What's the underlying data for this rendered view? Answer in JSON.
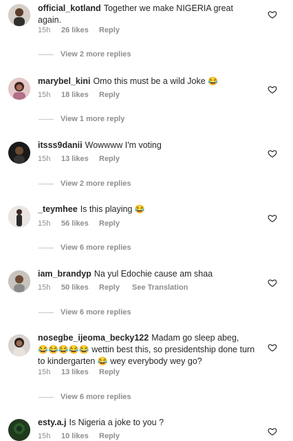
{
  "comments": [
    {
      "username": "official_kotland",
      "text": "Together we make NIGERIA great again.",
      "emoji": "",
      "time": "15h",
      "likes": "26 likes",
      "reply": "Reply",
      "view_replies": "View 2 more replies"
    },
    {
      "username": "marybel_kini",
      "text": "Omo this must be a wild Joke",
      "emoji": "😂",
      "time": "15h",
      "likes": "18 likes",
      "reply": "Reply",
      "view_replies": "View 1 more reply"
    },
    {
      "username": "itsss9danii",
      "text": "Wowwww I'm voting",
      "emoji": "",
      "time": "15h",
      "likes": "13 likes",
      "reply": "Reply",
      "view_replies": "View 2 more replies"
    },
    {
      "username": "_teymhee",
      "text": "Is this playing",
      "emoji": "😂",
      "time": "15h",
      "likes": "56 likes",
      "reply": "Reply",
      "view_replies": "View 6 more replies"
    },
    {
      "username": "iam_brandyp",
      "text": "Na yul Edochie cause am shaa",
      "emoji": "",
      "time": "15h",
      "likes": "50 likes",
      "reply": "Reply",
      "see_translation": "See Translation",
      "view_replies": "View 6 more replies"
    },
    {
      "username": "nosegbe_ijeoma_becky122",
      "text_part1": "Madam go sleep abeg,",
      "emoji_run": "😂😂😂😂😂",
      "text_part2": "wettin best this, so presidentship done turn to kindergarten",
      "emoji": "😂",
      "text_part3": "wey everybody wey go?",
      "time": "15h",
      "likes": "13 likes",
      "reply": "Reply",
      "view_replies": "View 6 more replies"
    },
    {
      "username": "esty.a.j",
      "text": "Is Nigeria a joke to you ?",
      "emoji": "",
      "time": "15h",
      "likes": "10 likes",
      "reply": "Reply"
    }
  ]
}
